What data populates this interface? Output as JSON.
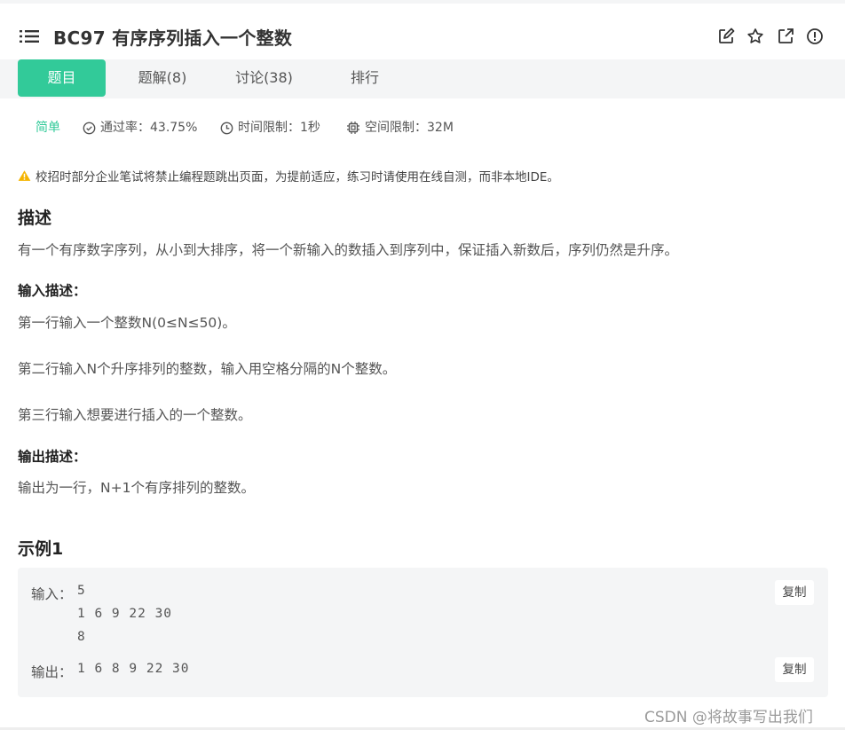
{
  "header": {
    "title": "BC97  有序序列插入一个整数",
    "icons": [
      "list-icon",
      "edit-icon",
      "star-icon",
      "share-icon",
      "report-icon"
    ]
  },
  "tabs": [
    {
      "label": "题目",
      "active": true
    },
    {
      "label": "题解(8)",
      "active": false
    },
    {
      "label": "讨论(38)",
      "active": false
    },
    {
      "label": "排行",
      "active": false
    }
  ],
  "meta": {
    "difficulty": "简单",
    "pass_rate": "通过率：43.75%",
    "time_limit": "时间限制：1秒",
    "space_limit": "空间限制：32M"
  },
  "notice": "校招时部分企业笔试将禁止编程题跳出页面，为提前适应，练习时请使用在线自测，而非本地IDE。",
  "description": {
    "heading": "描述",
    "text": "有一个有序数字序列，从小到大排序，将一个新输入的数插入到序列中，保证插入新数后，序列仍然是升序。",
    "input_heading": "输入描述：",
    "input_lines": [
      "第一行输入一个整数N(0≤N≤50)。",
      "第二行输入N个升序排列的整数，输入用空格分隔的N个整数。",
      "第三行输入想要进行插入的一个整数。"
    ],
    "output_heading": "输出描述：",
    "output_text": "输出为一行，N+1个有序排列的整数。"
  },
  "example": {
    "heading": "示例1",
    "input_label": "输入：",
    "input_lines": [
      "5",
      "1 6 9 22 30",
      "8"
    ],
    "output_label": "输出：",
    "output_line": "1 6 8 9 22 30",
    "copy_label": "复制"
  },
  "colors": {
    "accent": "#32ca99",
    "panel_bg": "#f4f5f6",
    "warning": "#f5b400"
  },
  "watermark": "CSDN @将故事写出我们"
}
